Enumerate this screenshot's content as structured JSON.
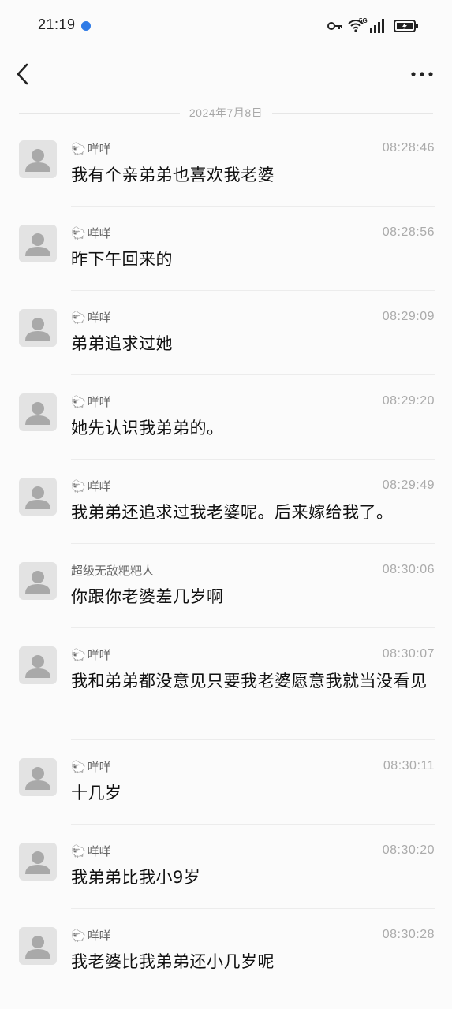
{
  "status_bar": {
    "time": "21:19",
    "network": "5G",
    "accent": "#2f7be6",
    "icons": [
      "key-icon",
      "wifi-icon",
      "signal-icon",
      "battery-charging-icon"
    ]
  },
  "nav": {
    "back_icon": "chevron-left-icon",
    "more_icon": "more-dots-icon"
  },
  "date_separator": "2024年7月8日",
  "messages": [
    {
      "sender": "咩咩",
      "sheep": true,
      "time": "08:28:46",
      "text": "我有个亲弟弟也喜欢我老婆"
    },
    {
      "sender": "咩咩",
      "sheep": true,
      "time": "08:28:56",
      "text": "昨下午回来的"
    },
    {
      "sender": "咩咩",
      "sheep": true,
      "time": "08:29:09",
      "text": "弟弟追求过她"
    },
    {
      "sender": "咩咩",
      "sheep": true,
      "time": "08:29:20",
      "text": "她先认识我弟弟的。"
    },
    {
      "sender": "咩咩",
      "sheep": true,
      "time": "08:29:49",
      "text": "我弟弟还追求过我老婆呢。后来嫁给我了。"
    },
    {
      "sender": "超级无敌粑粑人",
      "sheep": false,
      "time": "08:30:06",
      "text": "你跟你老婆差几岁啊"
    },
    {
      "sender": "咩咩",
      "sheep": true,
      "time": "08:30:07",
      "text": "我和弟弟都没意见只要我老婆愿意我就当没看见"
    },
    {
      "sender": "咩咩",
      "sheep": true,
      "time": "08:30:11",
      "text": "十几岁"
    },
    {
      "sender": "咩咩",
      "sheep": true,
      "time": "08:30:20",
      "text": "我弟弟比我小9岁"
    },
    {
      "sender": "咩咩",
      "sheep": true,
      "time": "08:30:28",
      "text": "我老婆比我弟弟还小几岁呢"
    }
  ]
}
